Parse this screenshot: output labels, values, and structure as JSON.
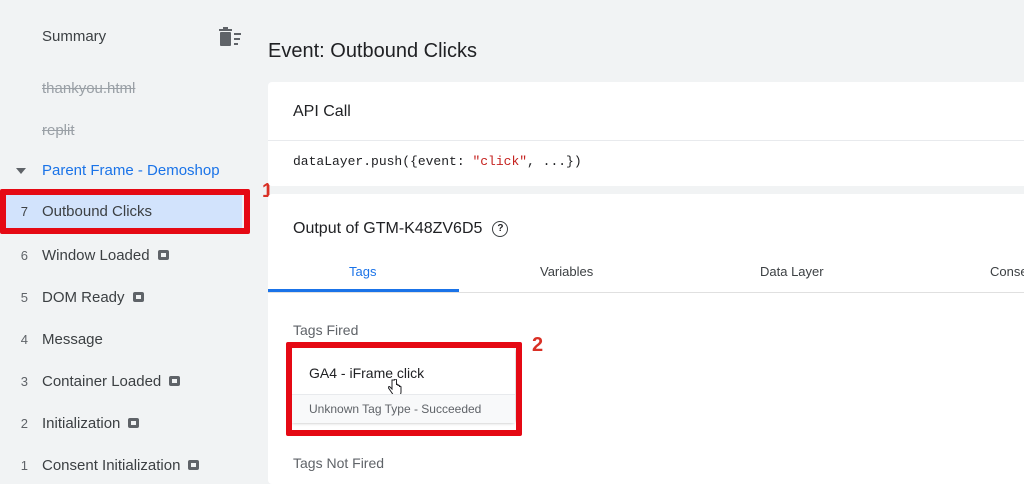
{
  "sidebar": {
    "summary": "Summary",
    "prior_pages": [
      "thankyou.html",
      "replit"
    ],
    "parent_frame": "Parent Frame - Demoshop",
    "events": [
      {
        "num": "7",
        "label": "Outbound Clicks",
        "selected": true,
        "badge": false
      },
      {
        "num": "6",
        "label": "Window Loaded",
        "badge": true
      },
      {
        "num": "5",
        "label": "DOM Ready",
        "badge": true
      },
      {
        "num": "4",
        "label": "Message",
        "badge": false
      },
      {
        "num": "3",
        "label": "Container Loaded",
        "badge": true
      },
      {
        "num": "2",
        "label": "Initialization",
        "badge": true
      },
      {
        "num": "1",
        "label": "Consent Initialization",
        "badge": true
      }
    ]
  },
  "annotations": {
    "marker1": "1",
    "marker2": "2",
    "highlight_color": "#e50914"
  },
  "main": {
    "title": "Event: Outbound Clicks",
    "api_call": {
      "title": "API Call",
      "code_prefix": "dataLayer.push({event: ",
      "code_string": "\"click\"",
      "code_suffix": ", ...})"
    },
    "output": {
      "title": "Output of GTM-K48ZV6D5",
      "tabs": [
        "Tags",
        "Variables",
        "Data Layer",
        "Conse"
      ],
      "active_tab": "Tags",
      "tags_fired_label": "Tags Fired",
      "tag": {
        "name": "GA4 - iFrame click",
        "status": "Unknown Tag Type - Succeeded"
      },
      "tags_not_fired_label": "Tags Not Fired"
    }
  },
  "colors": {
    "accent": "#1a73e8",
    "selected_bg": "#d2e3fc"
  }
}
